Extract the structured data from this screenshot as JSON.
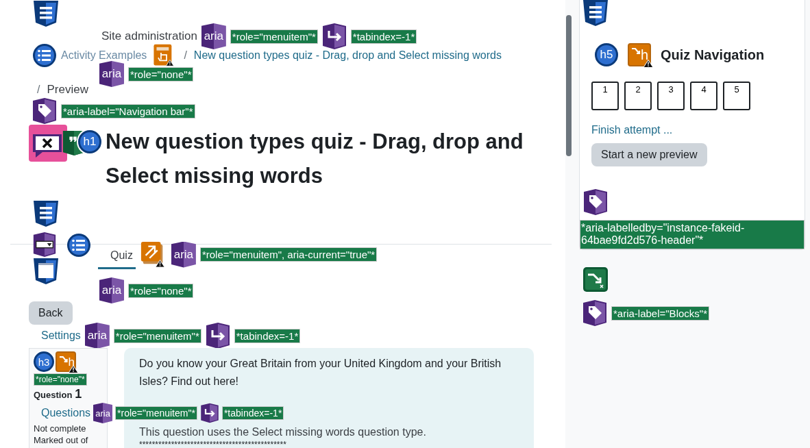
{
  "main": {
    "rows": [
      {
        "kind": "line",
        "items": [
          {
            "kind": "structure"
          }
        ]
      },
      {
        "kind": "line",
        "items": [
          {
            "kind": "text",
            "text": "Site administration"
          },
          {
            "kind": "aria",
            "text": "aria"
          },
          {
            "kind": "badge",
            "text": "*role=\"menuitem\"*"
          },
          {
            "kind": "tabindex"
          },
          {
            "kind": "badge",
            "text": "*tabindex=-1*"
          }
        ]
      },
      {
        "kind": "line",
        "items": [
          {
            "kind": "ordered-list"
          },
          {
            "kind": "muted-link",
            "text": "Activity Examples"
          },
          {
            "kind": "link-alert"
          },
          {
            "kind": "separator",
            "text": "/"
          },
          {
            "kind": "link",
            "text": "New question types quiz - Drag, drop and Select missing words"
          }
        ]
      },
      {
        "kind": "line",
        "items": [
          {
            "kind": "aria",
            "text": "aria"
          },
          {
            "kind": "badge",
            "text": "*role=\"none\"*"
          }
        ]
      },
      {
        "kind": "line",
        "items": [
          {
            "kind": "separator",
            "text": "/"
          },
          {
            "kind": "text",
            "text": "Preview"
          }
        ]
      },
      {
        "kind": "line",
        "items": [
          {
            "kind": "tag"
          },
          {
            "kind": "badge",
            "text": "*aria-label=\"Navigation bar\"*"
          }
        ]
      },
      {
        "kind": "title",
        "items": [
          {
            "kind": "error"
          },
          {
            "kind": "quote"
          },
          {
            "kind": "heading",
            "text": "h1"
          },
          {
            "kind": "title",
            "text": "New question types quiz - Drag, drop and Select missing words"
          }
        ]
      },
      {
        "kind": "line",
        "items": [
          {
            "kind": "structure"
          }
        ]
      },
      {
        "kind": "tabs",
        "icons": [
          {
            "kind": "select"
          },
          {
            "kind": "window"
          },
          {
            "kind": "list"
          }
        ],
        "tab": {
          "text": "Quiz",
          "selected": true
        },
        "items": [
          {
            "kind": "redundant-link"
          },
          {
            "kind": "aria",
            "text": "aria"
          },
          {
            "kind": "badge",
            "text": "*role=\"menuitem\", aria-current=\"true\"*"
          }
        ]
      },
      {
        "kind": "line",
        "items": [
          {
            "kind": "aria",
            "text": "aria"
          },
          {
            "kind": "badge",
            "text": "*role=\"none\"*"
          }
        ]
      },
      {
        "kind": "line",
        "items": [
          {
            "kind": "button",
            "text": "Back"
          }
        ]
      },
      {
        "kind": "line",
        "items": [
          {
            "kind": "link",
            "text": "Settings"
          },
          {
            "kind": "aria",
            "text": "aria"
          },
          {
            "kind": "badge",
            "text": "*role=\"menuitem\"*"
          },
          {
            "kind": "tabindex"
          },
          {
            "kind": "badge",
            "text": "*tabindex=-1*"
          }
        ]
      },
      {
        "kind": "question",
        "info": {
          "icons": [
            {
              "kind": "heading",
              "text": "h3"
            },
            {
              "kind": "heading-alert",
              "text": "h"
            },
            {
              "kind": "badge",
              "text": "*role=\"none\"*"
            }
          ],
          "label": "Question",
          "number": "1",
          "state": "Not complete",
          "marks": "Marked out of"
        },
        "overlay": [
          {
            "kind": "link",
            "text": "Questions"
          },
          {
            "kind": "aria",
            "text": "aria"
          },
          {
            "kind": "badge",
            "text": "*role=\"menuitem\"*"
          },
          {
            "kind": "tabindex"
          },
          {
            "kind": "badge",
            "text": "*tabindex=-1*"
          }
        ],
        "paragraphs": [
          "Do you know your Great Britain from your United Kingdom and your British Isles? Find out here!",
          "This question uses the Select missing words question type.",
          "**********************************************"
        ]
      }
    ]
  },
  "sidebar": {
    "top_icons": [
      {
        "kind": "structure"
      }
    ],
    "heading_icons": [
      {
        "kind": "heading",
        "text": "h5"
      },
      {
        "kind": "heading-alert",
        "text": "h"
      }
    ],
    "title": "Quiz Navigation",
    "questions": [
      {
        "label": "1"
      },
      {
        "label": "2"
      },
      {
        "label": "3"
      },
      {
        "label": "4"
      },
      {
        "label": "5"
      }
    ],
    "finish_link": "Finish attempt ...",
    "button": "Start a new preview",
    "label_icons": [
      {
        "kind": "tag"
      }
    ],
    "label_badge": "*aria-labelledby=\"instance-fakeid-64bae9fd2d576-header\"*",
    "after": [
      {
        "kind": "skip"
      }
    ],
    "blocks": [
      {
        "kind": "tag"
      },
      {
        "kind": "badge",
        "text": "*aria-label=\"Blocks\"*"
      }
    ]
  }
}
